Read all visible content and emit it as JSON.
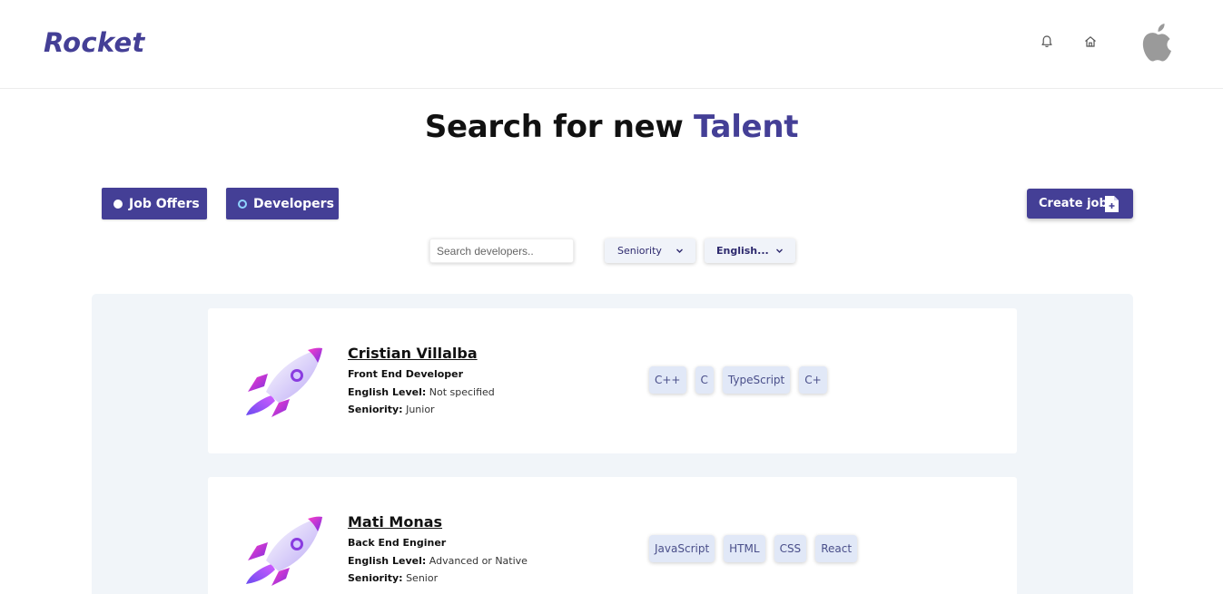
{
  "app": {
    "logo": "Rocket"
  },
  "header": {
    "icons": [
      "bell-icon",
      "home-icon",
      "apple-icon"
    ]
  },
  "page": {
    "title_prefix": "Search for new ",
    "title_accent": "Talent"
  },
  "toggles": {
    "job_offers": "Job Offers",
    "developers": "Developers"
  },
  "create_job": {
    "label": "Create job"
  },
  "search": {
    "placeholder": "Search developers.."
  },
  "filters": {
    "seniority": "Seniority",
    "english": "English..."
  },
  "labels": {
    "english_level": "English Level:",
    "seniority": "Seniority:"
  },
  "colors": {
    "accent": "#443f96",
    "panel": "#f1f5f9",
    "tag_bg": "#e1e8f7"
  },
  "developers": [
    {
      "name": "Cristian Villalba",
      "role": "Front End Developer",
      "english_level": "Not specified",
      "seniority": "Junior",
      "skills": [
        "C++",
        "C",
        "TypeScript",
        "C+"
      ]
    },
    {
      "name": "Mati Monas",
      "role": "Back End Enginer",
      "english_level": "Advanced or Native",
      "seniority": "Senior",
      "skills": [
        "JavaScript",
        "HTML",
        "CSS",
        "React"
      ]
    }
  ]
}
